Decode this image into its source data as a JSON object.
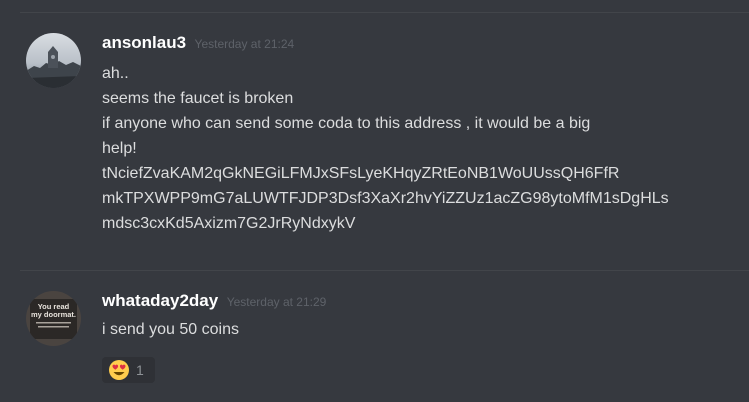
{
  "messages": [
    {
      "username": "ansonlau3",
      "timestamp": "Yesterday at 21:24",
      "lines": [
        "ah..",
        "seems the faucet is broken",
        "if anyone who can send some coda to this address , it would be a big",
        "help!",
        "tNciefZvaKAM2qGkNEGiLFMJxSFsLyeKHqyZRtEoNB1WoUUssQH6FfR",
        "mkTPXWPP9mG7aLUWTFJDP3Dsf3XaXr2hvYiZZUz1acZG98ytoMfM1sDgHLs",
        "mdsc3cxKd5Axizm7G2JrRyNdxykV"
      ]
    },
    {
      "username": "whataday2day",
      "timestamp": "Yesterday at 21:29",
      "avatar_text": [
        "You read",
        "my doormat."
      ],
      "lines": [
        "i send you 50 coins"
      ],
      "reaction": {
        "emoji": "heart-eyes-emoji",
        "count": "1"
      }
    }
  ],
  "colors": {
    "background": "#36393f",
    "username": "#ffffff",
    "timestamp": "#5e6269",
    "text": "#dcddde",
    "reaction_bg": "#2f3136"
  }
}
